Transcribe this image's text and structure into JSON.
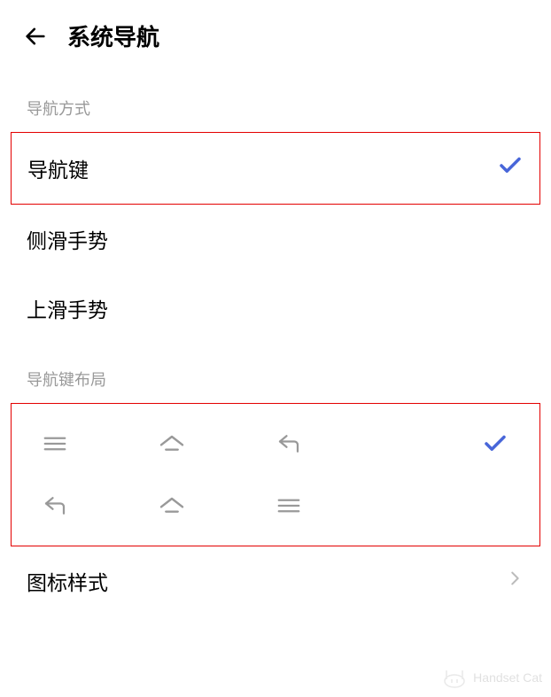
{
  "header": {
    "title": "系统导航"
  },
  "sections": {
    "navigation_method": {
      "label": "导航方式",
      "options": {
        "nav_keys": "导航键",
        "side_swipe": "侧滑手势",
        "up_swipe": "上滑手势"
      }
    },
    "nav_key_layout": {
      "label": "导航键布局"
    },
    "icon_style": {
      "label": "图标样式"
    }
  },
  "watermark": "Handset Cat"
}
